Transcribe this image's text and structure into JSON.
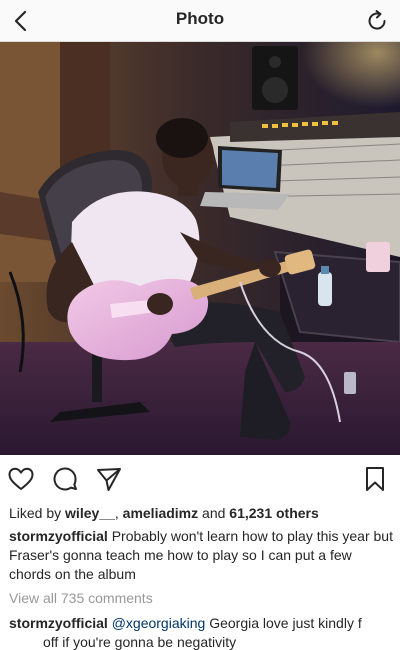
{
  "header": {
    "title": "Photo",
    "back_icon": "chevron-left-icon",
    "refresh_icon": "refresh-icon"
  },
  "post": {
    "image_icon": "photo",
    "actions": {
      "like_icon": "heart-icon",
      "comment_icon": "comment-icon",
      "share_icon": "send-icon",
      "save_icon": "bookmark-icon"
    },
    "likes": {
      "prefix": "Liked by ",
      "user1": "wiley__",
      "separator": ", ",
      "user2": "ameliadimz",
      "middle": " and ",
      "count": "61,231 others"
    },
    "caption": {
      "username": "stormzyofficial",
      "text": "Probably won't learn how to play this year but Fraser's gonna teach me how to play so I can put a few chords on the album"
    },
    "view_all_comments": "View all 735 comments",
    "comments": [
      {
        "username": "stormzyofficial",
        "mention": "@xgeorgiaking",
        "text_part1": "Georgia love just kindly f",
        "text_part2": "off if you're gonna be negativity"
      }
    ]
  },
  "colors": {
    "link": "#003569",
    "muted": "#999999",
    "text": "#262626"
  }
}
